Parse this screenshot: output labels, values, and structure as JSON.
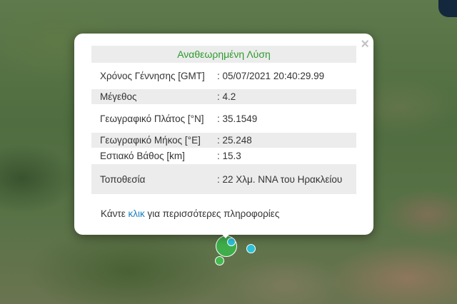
{
  "popup": {
    "title": "Αναθεωρημένη Λύση",
    "close_label": "×",
    "rows": [
      {
        "label": "Χρόνος Γέννησης [GMT]",
        "value": ": 05/07/2021 20:40:29.99"
      },
      {
        "label": "Μέγεθος",
        "value": ": 4.2"
      },
      {
        "label": "Γεωγραφικό Πλάτος [°N]",
        "value": ": 35.1549"
      },
      {
        "label": "Γεωγραφικό Μήκος [°E]",
        "value": ": 25.248"
      },
      {
        "label": "Εστιακό Βάθος [km]",
        "value": ": 15.3"
      },
      {
        "label": "Τοποθεσία",
        "value": ": 22 Χλμ. ΝΝΑ του Ηρακλείου"
      }
    ],
    "more_prefix": "Κάντε ",
    "more_link": "κλικ",
    "more_suffix": " για περισσότερες πληροφορίες"
  },
  "colors": {
    "title": "#2e9a2e",
    "link": "#1a7fbf",
    "marker_main": "#3fae4a",
    "marker_small": "#45b84f",
    "marker_cyan": "#2bc2d8"
  }
}
